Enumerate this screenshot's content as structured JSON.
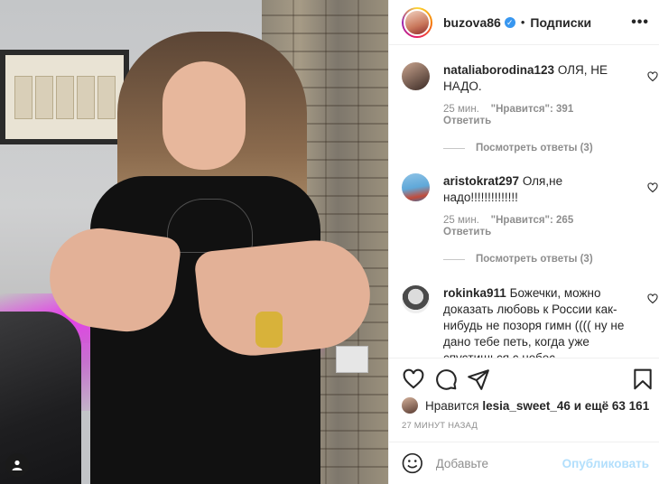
{
  "header": {
    "username": "buzova86",
    "separator": "•",
    "follow_label": "Подписки",
    "more_label": "•••",
    "verified_mark": "✓"
  },
  "comments": [
    {
      "user": "nataliaborodina123",
      "text": "ОЛЯ, НЕ НАДО.",
      "time": "25 мин.",
      "likes": "\"Нравится\": 391",
      "reply": "Ответить",
      "view_replies": "Посмотреть ответы (3)"
    },
    {
      "user": "aristokrat297",
      "text": "Оля,не надо!!!!!!!!!!!!!!",
      "time": "25 мин.",
      "likes": "\"Нравится\": 265",
      "reply": "Ответить",
      "view_replies": "Посмотреть ответы (3)"
    },
    {
      "user": "rokinka911",
      "text": "Божечки, можно доказать любовь к России как-нибудь не позоря гимн (((( ну не дано тебе петь, когда уже спустишься с небес"
    }
  ],
  "likes": {
    "prefix": "Нравится",
    "user": "lesia_sweet_46",
    "suffix": "и ещё 63 161"
  },
  "time_ago": "27 МИНУТ НАЗАД",
  "add_comment": {
    "placeholder": "Добавьте",
    "publish_label": "Опубликовать"
  },
  "colors": {
    "verified": "#3897f0",
    "publish_disabled": "#b2dffc",
    "muted_text": "#8e8e8e"
  },
  "icons": [
    "heart-icon",
    "comment-icon",
    "share-icon",
    "bookmark-icon",
    "emoji-icon",
    "more-icon",
    "user-tag-icon"
  ]
}
